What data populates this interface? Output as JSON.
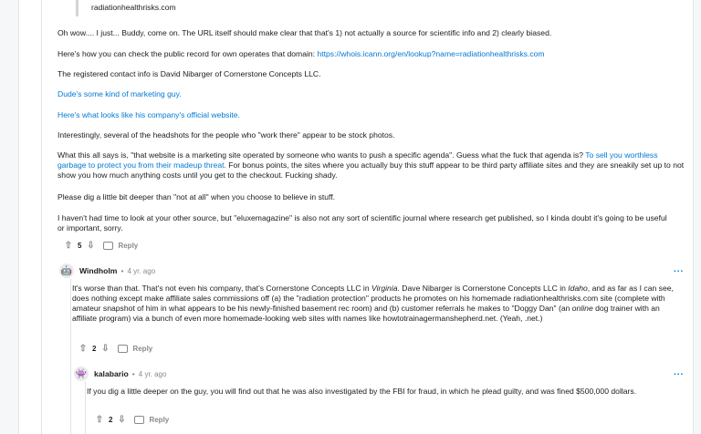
{
  "quote_text": "radiationhealthrisks.com",
  "parent": {
    "p1": "Oh wow.... I just... Buddy, come on. The URL itself should make clear that that's 1) not actually a source for scientific info and 2) clearly biased.",
    "p2_text": "Here's how you can check the public record for own operates that domain: ",
    "p2_link": "https://whois.icann.org/en/lookup?name=radiationhealthrisks.com",
    "p3": "The registered contact info is David Nibarger of Cornerstone Concepts LLC.",
    "p4_link": "Dude's some kind of marketing guy.",
    "p5_link": "Here's what looks like his company's official website.",
    "p6": "Interestingly, several of the headshots for the people who \"work there\" appear to be stock photos.",
    "p7_a": "What this all says is, \"that website is a marketing site operated by someone who wants to push a specific agenda\". Guess what the fuck that agenda is? ",
    "p7_link": "To sell you worthless garbage to protect you from their madeup threat.",
    "p7_b": " For bonus points, the sites where you actually buy this stuff appear to be third party affiliate sites and they are sneakily set up to not show you how much anything costs until you get to the checkout. Fucking shady.",
    "p8": "Please dig a little bit deeper than \"not at all\" when you choose to believe in stuff.",
    "p9": "I haven't had time to look at your other source, but \"eluxemagazine\" is also not any sort of scientific journal where research get published, so I kinda doubt it's going to be useful or important, sorry.",
    "votes": "5",
    "reply_label": "Reply"
  },
  "windholm": {
    "author": "Windholm",
    "time": "4 yr. ago",
    "more": "...",
    "t1": "It's worse than that. That's not even his company, that's Cornerstone Concepts LLC in ",
    "t1_em": "Virginia",
    "t2": ". Dave Nibarger is Cornerstone Concepts LLC in ",
    "t2_em": "Idaho",
    "t3": ", and as far as I can see, does nothing except make affiliate sales commissions off (a) the \"radiation protection\" products he promotes on his homemade radiationhealthrisks.com site (complete with amateur snapshot of him in what appears to be his newly-finished basement rec room) and (b) customer referrals he makes to \"Doggy Dan\" (an ",
    "t3_em": "online",
    "t4": " dog trainer with an affiliate program) via a bunch of even more homemade-looking web sites with names like howtotrainagermanshepherd.net. (Yeah, .net.)",
    "votes": "2",
    "reply_label": "Reply"
  },
  "kalabario": {
    "author": "kalabario",
    "time": "4 yr. ago",
    "more": "...",
    "text": "If you dig a little deeper on the guy, you will find out that he was also investigated by the FBI for fraud, in which he plead guilty, and was fined $500,000 dollars.",
    "votes": "2",
    "reply_label": "Reply"
  },
  "icons": {
    "upvote": "upvote-icon",
    "downvote": "downvote-icon",
    "reply": "comment-bubble-icon",
    "avatar": "snoo-avatar-icon"
  },
  "colors": {
    "link": "#0079d3",
    "meta": "#878a8c",
    "text": "#1c1c1c"
  }
}
